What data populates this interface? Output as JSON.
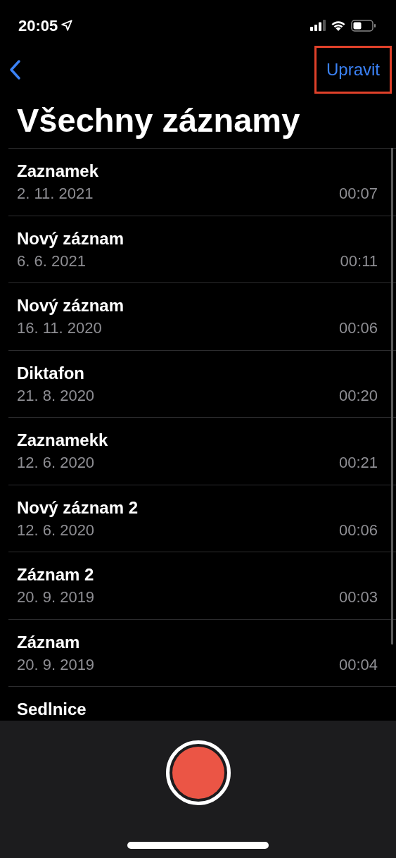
{
  "status_bar": {
    "time": "20:05"
  },
  "nav": {
    "edit_button": {
      "label": "Upravit",
      "highlighted": true
    }
  },
  "title": "Všechny záznamy",
  "recordings": [
    {
      "name": "Zaznamek",
      "date": "2. 11. 2021",
      "duration": "00:07"
    },
    {
      "name": "Nový záznam",
      "date": "6. 6. 2021",
      "duration": "00:11"
    },
    {
      "name": "Nový záznam",
      "date": "16. 11. 2020",
      "duration": "00:06"
    },
    {
      "name": "Diktafon",
      "date": "21. 8. 2020",
      "duration": "00:20"
    },
    {
      "name": "Zaznamekk",
      "date": "12. 6. 2020",
      "duration": "00:21"
    },
    {
      "name": "Nový záznam 2",
      "date": "12. 6. 2020",
      "duration": "00:06"
    },
    {
      "name": "Záznam 2",
      "date": "20. 9. 2019",
      "duration": "00:03"
    },
    {
      "name": "Záznam",
      "date": "20. 9. 2019",
      "duration": "00:04"
    },
    {
      "name": "Sedlnice"
    }
  ]
}
